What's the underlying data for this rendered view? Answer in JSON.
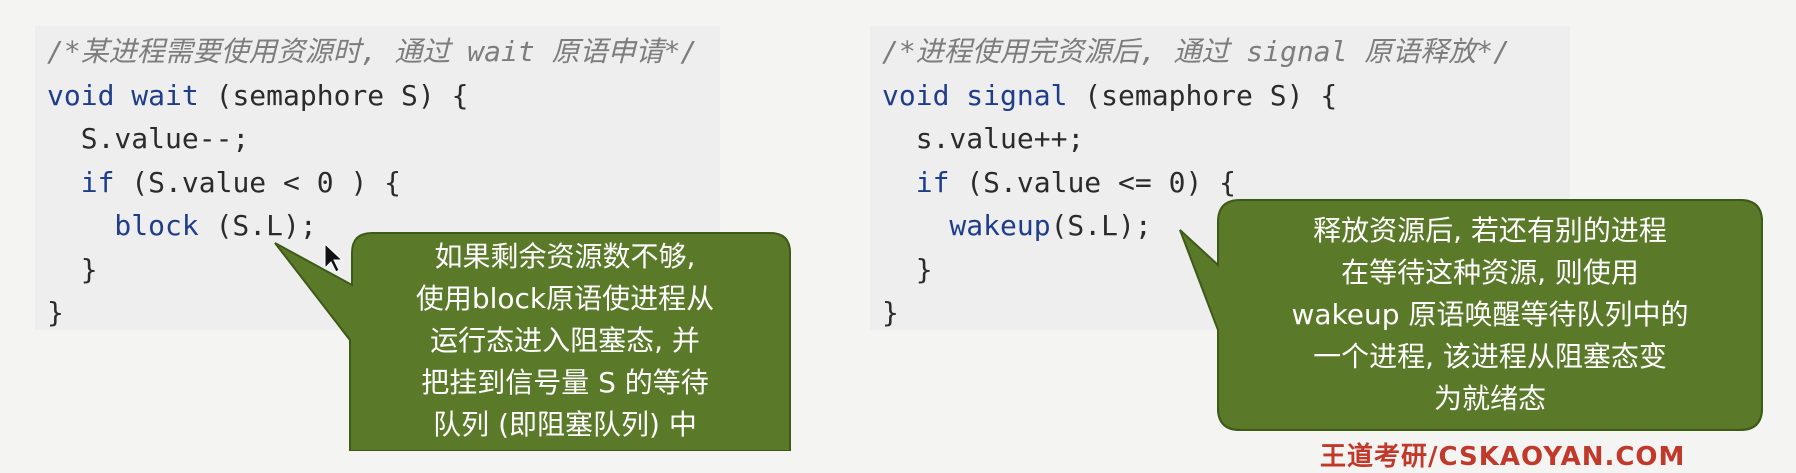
{
  "left_code": {
    "comment": "/*某进程需要使用资源时, 通过 wait 原语申请*/",
    "line1_kw": "void",
    "line1_fn": "wait",
    "line1_rest": " (semaphore S) {",
    "line2": "  S.value--;",
    "line3_kw": "  if",
    "line3_rest": " (S.value < 0 ) {",
    "line4_fn": "    block",
    "line4_rest": " (S.L);",
    "line5": "  }",
    "line6": "}"
  },
  "right_code": {
    "comment": "/*进程使用完资源后, 通过 signal 原语释放*/",
    "line1_kw": "void",
    "line1_fn": "signal",
    "line1_rest": " (semaphore S) {",
    "line2": "  s.value++;",
    "line3_kw": "  if",
    "line3_rest": " (S.value <= 0) {",
    "line4_fn": "    wakeup",
    "line4_rest": "(S.L);",
    "line5": "  }",
    "line6": "}"
  },
  "left_bubble": {
    "lines": [
      "如果剩余资源数不够,",
      "使用block原语使进程从",
      "运行态进入阻塞态, 并",
      "把挂到信号量 S 的等待",
      "队列 (即阻塞队列) 中"
    ]
  },
  "right_bubble": {
    "lines": [
      "释放资源后, 若还有别的进程",
      "在等待这种资源, 则使用",
      "wakeup 原语唤醒等待队列中的",
      "一个进程, 该进程从阻塞态变",
      "为就绪态"
    ]
  },
  "watermark": "王道考研/CSKAOYAN.COM",
  "colors": {
    "bubble_fill": "#5a7a2a",
    "bubble_stroke": "#3e5a18"
  }
}
